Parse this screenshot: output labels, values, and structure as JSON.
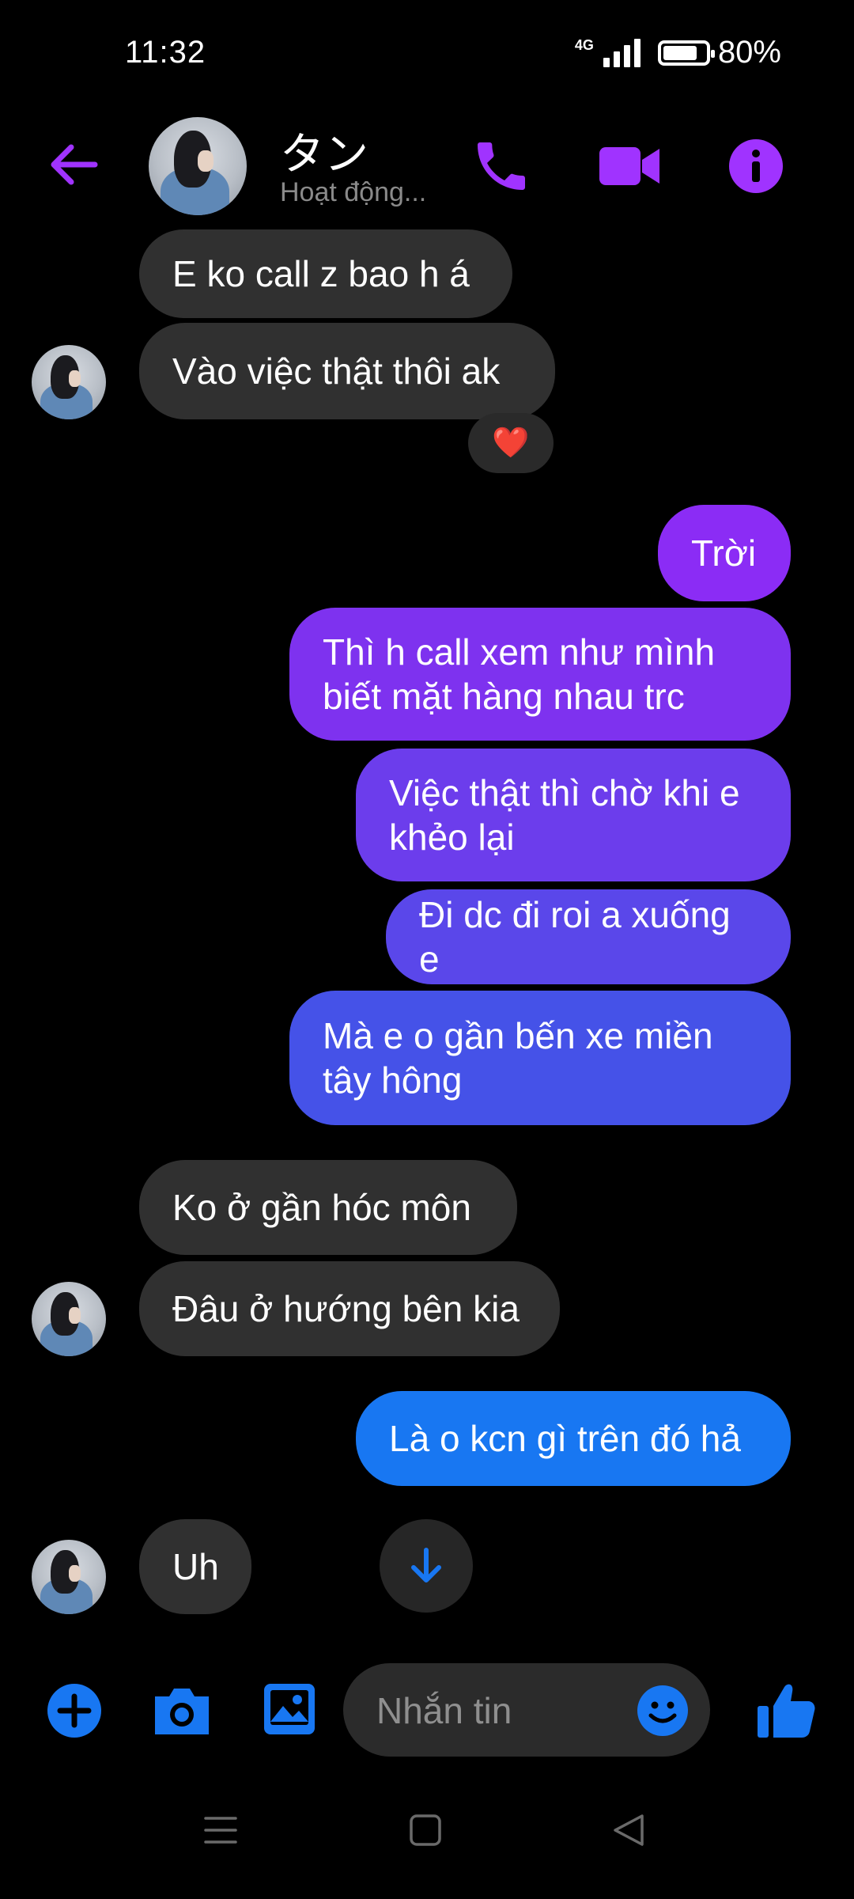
{
  "status_bar": {
    "time": "11:32",
    "network": "4G",
    "battery": "80%"
  },
  "header": {
    "name": "タン",
    "status": "Hoạt động..."
  },
  "messages": {
    "m1": "E ko call z bao h á",
    "m2": "Vào việc thật thôi ak",
    "m2_reaction": "❤️",
    "m3": "Trời",
    "m4_l1": "Thì h call xem như mình",
    "m4_l2": "biết mặt hàng nhau trc",
    "m5_l1": "Việc thật thì chờ khi e",
    "m5_l2": "khẻo lại",
    "m6": "Đi dc đi roi a xuống e",
    "m7_l1": "Mà e o gần bến xe miền",
    "m7_l2": "tây hông",
    "m8": "Ko ở gần hóc môn",
    "m9": "Đâu ở hướng bên kia",
    "m10": "Là o kcn gì trên đó hả",
    "m11": "Uh"
  },
  "composer": {
    "placeholder": "Nhắn tin"
  },
  "colors": {
    "accent": "#A033FF",
    "messenger_blue": "#1877F2",
    "incoming_bubble": "#303030"
  },
  "icons": [
    "back-arrow-icon",
    "phone-icon",
    "video-camera-icon",
    "info-icon",
    "arrow-down-icon",
    "plus-icon",
    "camera-icon",
    "image-icon",
    "emoji-icon",
    "thumbs-up-icon",
    "menu-icon",
    "home-square-icon",
    "back-triangle-icon"
  ]
}
